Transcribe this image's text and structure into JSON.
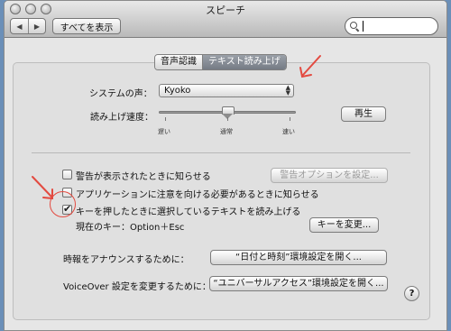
{
  "window": {
    "title": "スピーチ"
  },
  "toolbar": {
    "back_glyph": "◀",
    "forward_glyph": "▶",
    "show_all": "すべてを表示"
  },
  "search": {
    "value": "",
    "placeholder": ""
  },
  "tabs": [
    {
      "label": "音声認識",
      "active": false
    },
    {
      "label": "テキスト読み上げ",
      "active": true
    }
  ],
  "tts": {
    "voice_label": "システムの声：",
    "voice_value": "Kyoko",
    "rate_label": "読み上げ速度：",
    "rate_min": "遅い",
    "rate_mid": "通常",
    "rate_max": "速い",
    "play_button": "再生"
  },
  "options": {
    "alert_label": "警告が表示されたときに知らせる",
    "alert_checked": false,
    "alert_button": "警告オプションを設定...",
    "app_label": "アプリケーションに注意を向ける必要があるときに知らせる",
    "app_checked": false,
    "key_label": "キーを押したときに選択しているテキストを読み上げる",
    "key_checked": true,
    "current_key": "現在のキー：Option＋Esc",
    "change_key_button": "キーを変更..."
  },
  "clock": {
    "label": "時報をアナウンスするために：",
    "button": "“日付と時刻”環境設定を開く..."
  },
  "voiceover": {
    "label": "VoiceOver 設定を変更するために：",
    "button": "“ユニバーサルアクセス”環境設定を開く..."
  },
  "help": {
    "glyph": "?"
  },
  "colors": {
    "annotation": "#e34a40",
    "window_bg": "#e6e6e6",
    "active_tab": "#7d838c"
  }
}
